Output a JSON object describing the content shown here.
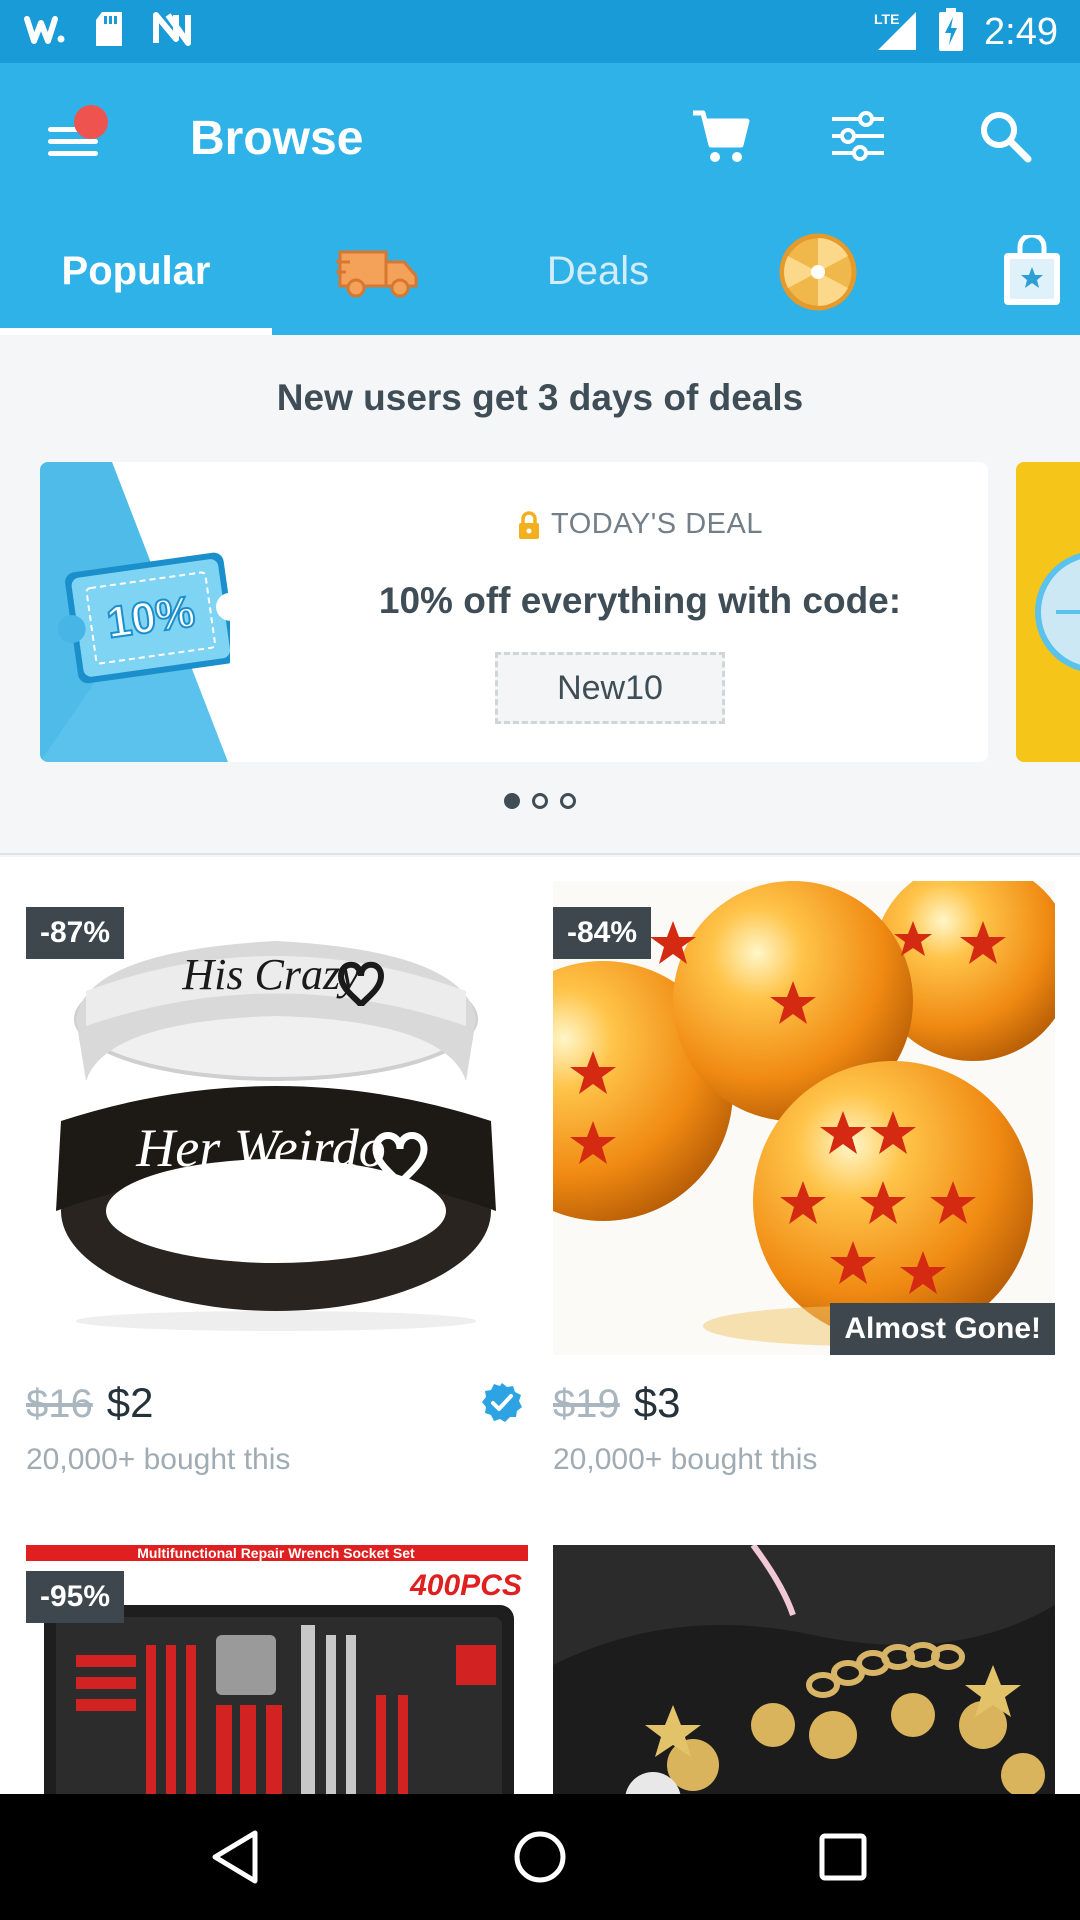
{
  "status_bar": {
    "time": "2:49",
    "network": "LTE",
    "icons": [
      "wish-icon",
      "sd-card-icon",
      "nfc-icon",
      "signal-icon",
      "battery-charging-icon"
    ]
  },
  "app_bar": {
    "title": "Browse",
    "has_notification": true,
    "icons": [
      "menu-icon",
      "cart-icon",
      "filter-icon",
      "search-icon"
    ]
  },
  "tabs": [
    {
      "label": "Popular",
      "active": true
    },
    {
      "label": "",
      "icon": "delivery-truck-icon",
      "active": false
    },
    {
      "label": "Deals",
      "active": false
    },
    {
      "label": "",
      "icon": "spin-wheel-icon",
      "active": false
    },
    {
      "label": "",
      "icon": "shopping-bag-icon",
      "active": false
    }
  ],
  "promo": {
    "heading": "New users get 3 days of deals",
    "card": {
      "ticket_text": "10%",
      "caption": "TODAY'S DEAL",
      "title": "10% off everything with code:",
      "code": "New10"
    },
    "pager": {
      "count": 3,
      "active_index": 0
    }
  },
  "products": [
    {
      "discount": "-87%",
      "old_price": "$16",
      "new_price": "$2",
      "bought": "20,000+ bought this",
      "verified": true,
      "badge": "",
      "image": "couple-rings-his-crazy-her-weirdo",
      "ring_text_1": "His Crazy",
      "ring_text_2": "Her Weirdo"
    },
    {
      "discount": "-84%",
      "old_price": "$19",
      "new_price": "$3",
      "bought": "20,000+ bought this",
      "verified": false,
      "badge": "Almost Gone!",
      "image": "orange-star-crystal-balls"
    },
    {
      "discount": "-95%",
      "image": "repair-tool-set",
      "banner_text": "Multifunctional Repair Wrench Socket Set",
      "count_text": "400PCS"
    },
    {
      "discount": "",
      "image": "gold-charm-bracelet"
    }
  ],
  "nav_bar": {
    "icons": [
      "back-icon",
      "home-icon",
      "recents-icon"
    ]
  },
  "colors": {
    "brand_blue": "#2fb2e8",
    "status_blue": "#189bd6",
    "dark_text": "#3f4d57",
    "badge_bg": "#3d474d",
    "notification": "#ef5350"
  }
}
